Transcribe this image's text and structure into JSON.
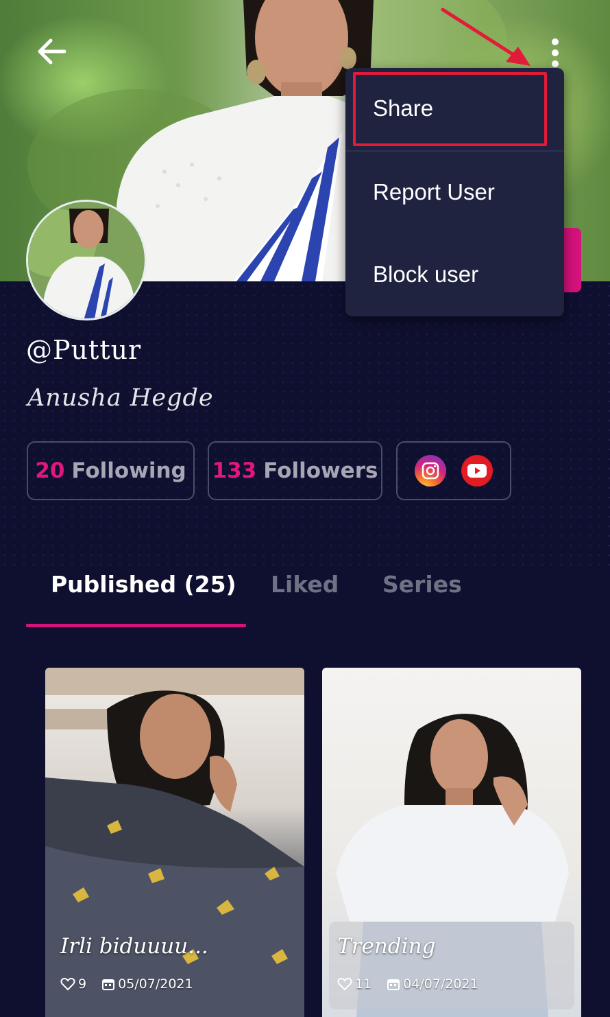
{
  "profile": {
    "username": "@Puttur",
    "full_name": "Anusha Hegde",
    "following_count": "20",
    "following_label": "Following",
    "followers_count": "133",
    "followers_label": "Followers"
  },
  "menu": {
    "items": [
      "Share",
      "Report User",
      "Block user"
    ],
    "highlighted": "Share"
  },
  "tabs": [
    {
      "label": "Published (25)",
      "active": true
    },
    {
      "label": "Liked",
      "active": false
    },
    {
      "label": "Series",
      "active": false
    }
  ],
  "posts": [
    {
      "title": "Irli biduuuu...",
      "likes": "9",
      "date": "05/07/2021"
    },
    {
      "title": "Trending",
      "likes": "11",
      "date": "04/07/2021"
    }
  ],
  "icons": {
    "back": "arrow-left-icon",
    "more": "more-vertical-icon",
    "instagram": "instagram-icon",
    "youtube": "youtube-icon",
    "like": "heart-icon",
    "date": "calendar-icon"
  },
  "colors": {
    "background": "#0f1030",
    "accent": "#d6127c",
    "menu_bg": "#1f2340",
    "annotation": "#e11b38"
  }
}
